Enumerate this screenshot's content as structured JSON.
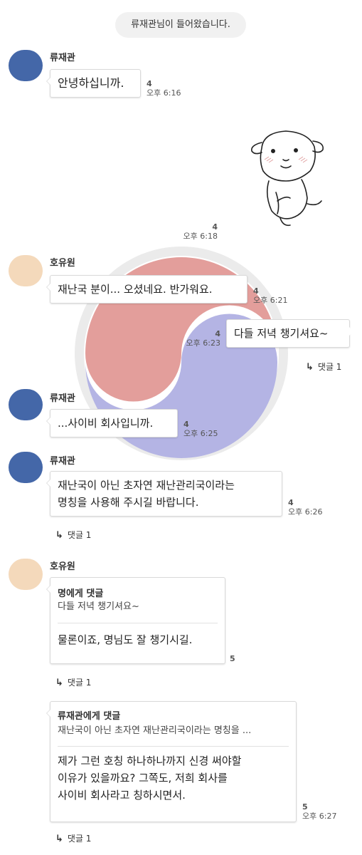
{
  "notice": "류재관님이 들어왔습니다.",
  "messages": [
    {
      "sender": "류재관",
      "text": "안녕하십니까.",
      "count": "4",
      "time": "오후 6:16"
    },
    {
      "count": "4",
      "time": "오후 6:18",
      "sticker": "puppy-sticker"
    },
    {
      "sender": "호유원",
      "text": "재난국 분이... 오셨네요. 반가워요.",
      "count": "4",
      "time": "오후 6:21"
    },
    {
      "text": "다들 저녁 챙기셔요~",
      "count": "4",
      "time": "오후 6:23",
      "reply": "댓글 1"
    },
    {
      "sender": "류재관",
      "text": "...사이비 회사입니까.",
      "count": "4",
      "time": "오후 6:25"
    },
    {
      "sender": "류재관",
      "lines": [
        "재난국이 아닌 초자연 재난관리국이라는",
        "명칭을 사용해 주시길 바랍니다."
      ],
      "count": "4",
      "time": "오후 6:26",
      "reply": "댓글 1"
    },
    {
      "sender": "호유원",
      "quote_title": "명에게 댓글",
      "quote_text": "다들 저녁 챙기셔요~",
      "text": "물론이죠, 명님도 잘 챙기시길.",
      "count": "5",
      "reply": "댓글 1"
    },
    {
      "quote_title": "류재관에게 댓글",
      "quote_text": "재난국이 아닌 초자연 재난관리국이라는 명칭을 ...",
      "lines": [
        "제가 그런 호칭 하나하나까지 신경 써야할",
        "이유가 있을까요? 그쪽도, 저희 회사를",
        "사이비 회사라고 칭하시면서."
      ],
      "count": "5",
      "time": "오후 6:27",
      "reply": "댓글 1"
    }
  ],
  "colors": {
    "avatar_blue": "#4467a8",
    "avatar_beige": "#f4d9bb",
    "emblem_red": "#e39e9b",
    "emblem_blue": "#b4b4e4",
    "emblem_ring": "#ebebeb"
  }
}
